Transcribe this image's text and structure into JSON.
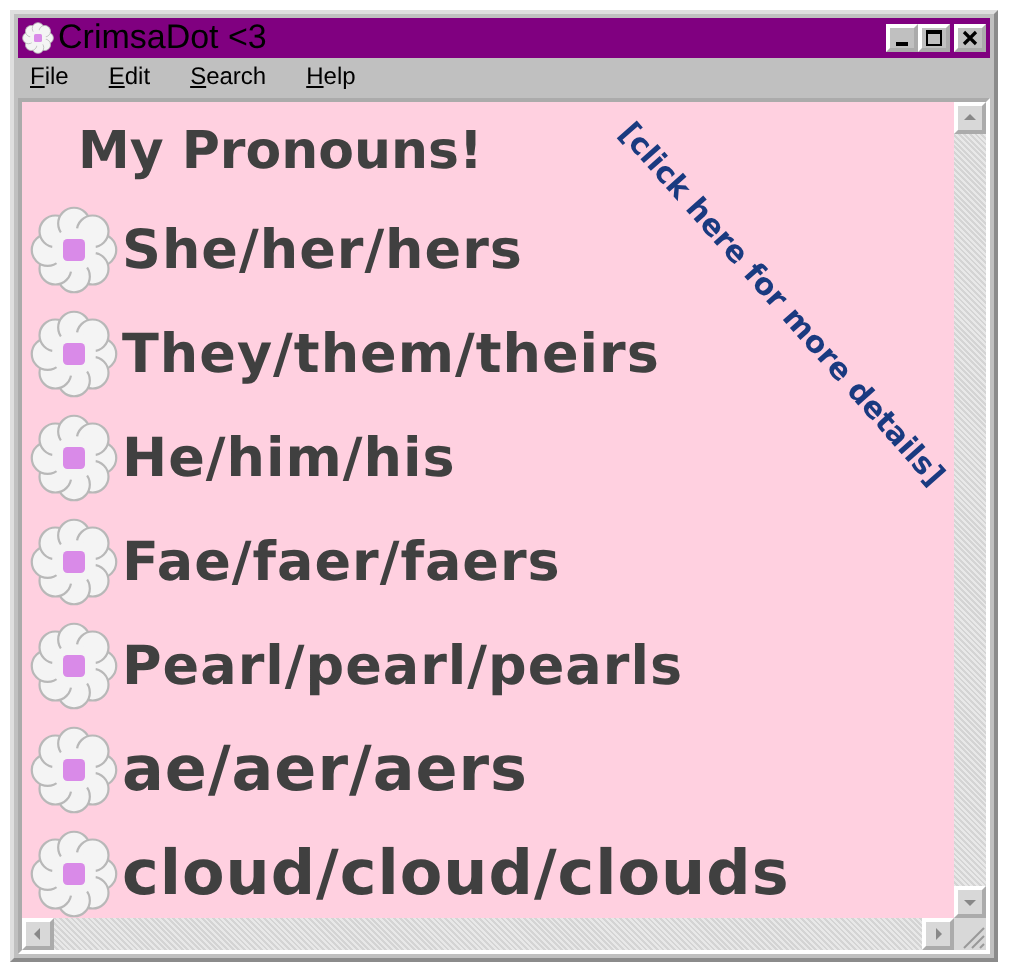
{
  "window": {
    "title": "CrimsaDot <3"
  },
  "menu": [
    "File",
    "Edit",
    "Search",
    "Help"
  ],
  "content": {
    "heading": "My Pronouns!",
    "link": "[click here for more details]",
    "pronouns": [
      "She/her/hers",
      "They/them/theirs",
      "He/him/his",
      "Fae/faer/faers",
      "Pearl/pearl/pearls",
      "ae/aer/aers",
      "cloud/cloud/clouds"
    ]
  }
}
